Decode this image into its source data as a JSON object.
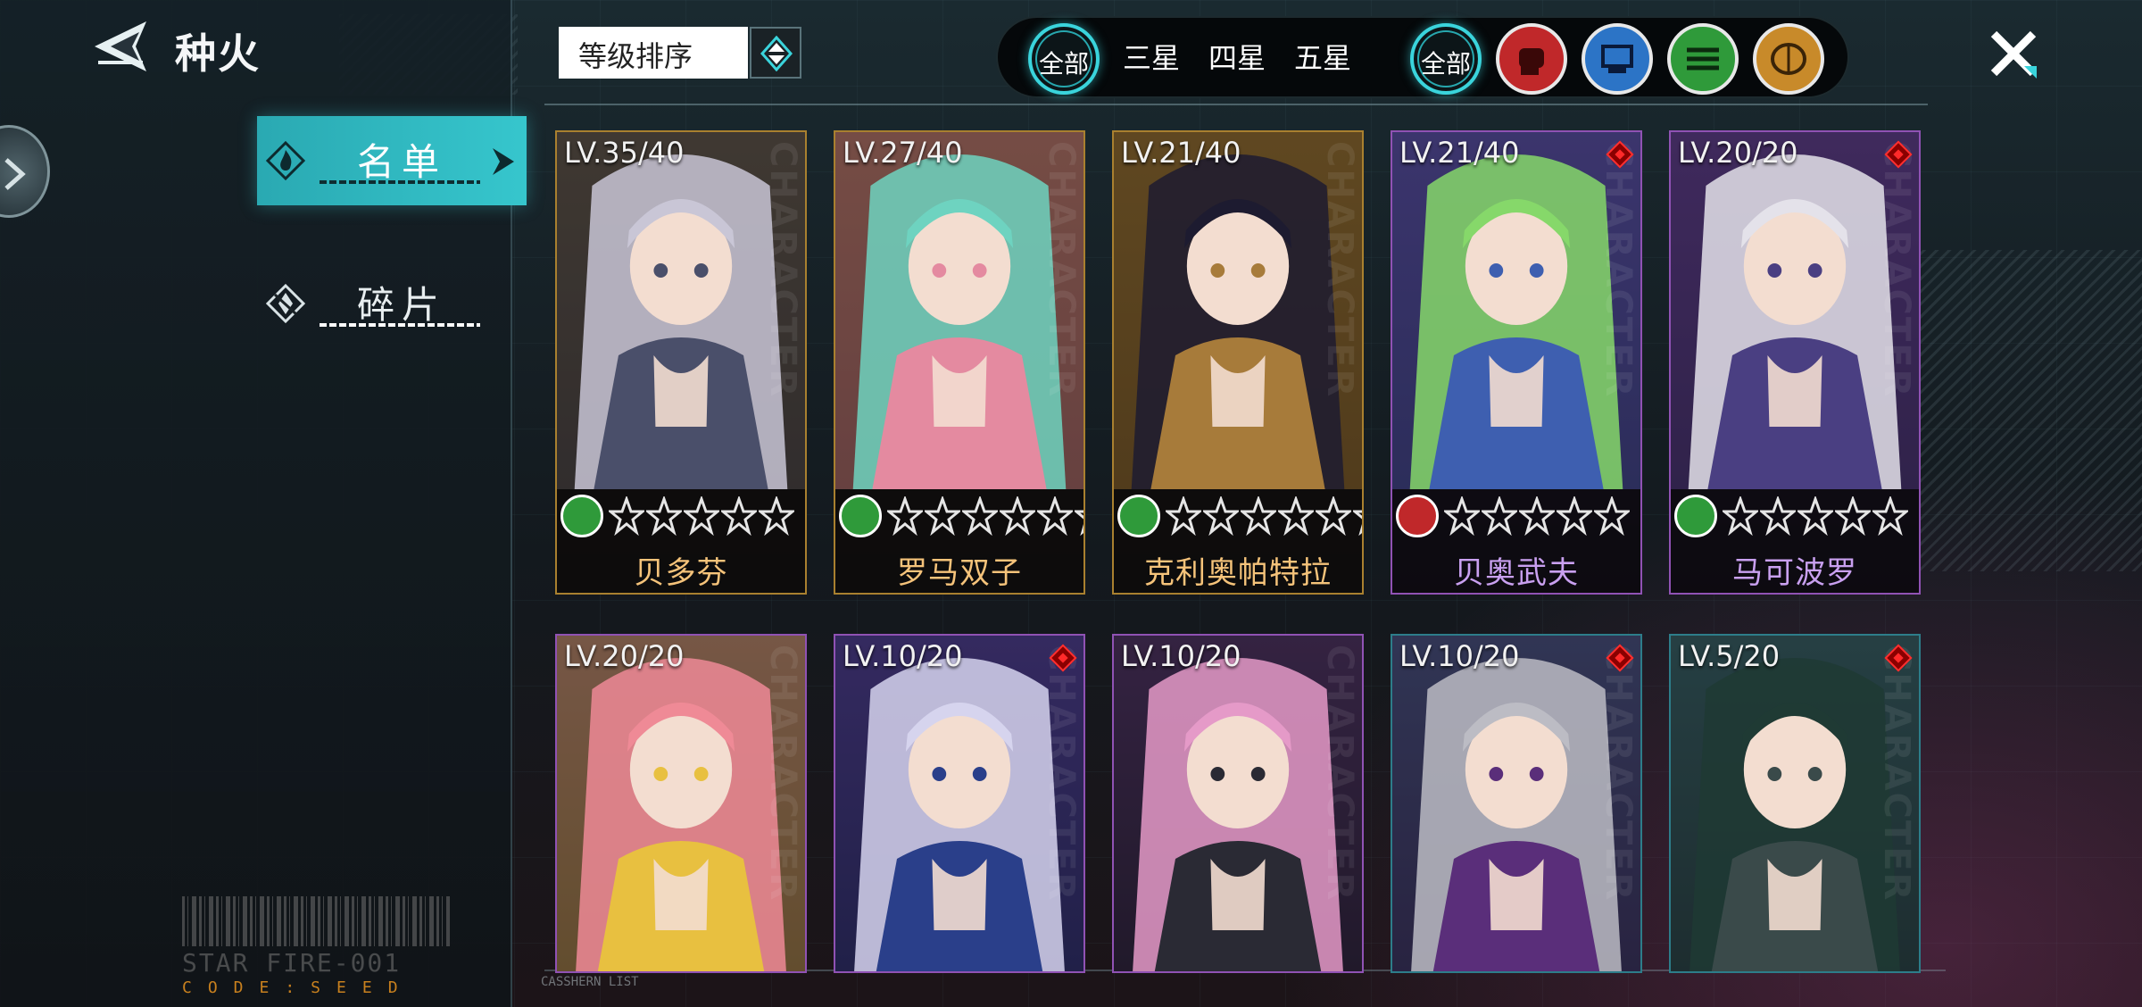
{
  "header": {
    "title": "种火",
    "back_icon": "back-arrow-icon"
  },
  "sidebar": {
    "tabs": [
      {
        "label": "名单",
        "active": true,
        "icon": "flame-icon"
      },
      {
        "label": "碎片",
        "active": false,
        "icon": "shard-icon"
      }
    ],
    "footer": {
      "line1": "STAR FIRE-001",
      "line2": "CODE:SEED"
    }
  },
  "toolbar": {
    "sort_label": "等级排序",
    "rarity_filters": [
      {
        "label": "全部",
        "selected": true
      },
      {
        "label": "三星",
        "selected": false
      },
      {
        "label": "四星",
        "selected": false
      },
      {
        "label": "五星",
        "selected": false
      }
    ],
    "class_filters": [
      {
        "label": "全部",
        "selected": true
      },
      {
        "name": "fist-class-icon",
        "color": "#c0282a"
      },
      {
        "name": "tech-class-icon",
        "color": "#2c74c6"
      },
      {
        "name": "speed-class-icon",
        "color": "#2f9a3a"
      },
      {
        "name": "mind-class-icon",
        "color": "#c88a2a"
      }
    ]
  },
  "list_caption": "CASSHERN LIST",
  "card_watermark": "CHARACTER",
  "characters": [
    {
      "level": "LV.35/40",
      "name": "贝多芬",
      "stars": 5,
      "rarity": "gold",
      "class_color": "#2f9a3a",
      "gem": false,
      "palette": [
        "#c9c6d6",
        "#4a4f6a"
      ]
    },
    {
      "level": "LV.27/40",
      "name": "罗马双子",
      "stars": 6,
      "rarity": "gold",
      "class_color": "#2f9a3a",
      "gem": false,
      "palette": [
        "#6ed3c0",
        "#e48aa0"
      ]
    },
    {
      "level": "LV.21/40",
      "name": "克利奥帕特拉",
      "stars": 6,
      "rarity": "gold",
      "class_color": "#2f9a3a",
      "gem": false,
      "palette": [
        "#1d1b30",
        "#a77b3a"
      ]
    },
    {
      "level": "LV.21/40",
      "name": "贝奥武夫",
      "stars": 5,
      "rarity": "purple",
      "class_color": "#c0282a",
      "gem": true,
      "palette": [
        "#86d86a",
        "#3e5fb0"
      ]
    },
    {
      "level": "LV.20/20",
      "name": "马可波罗",
      "stars": 5,
      "rarity": "purple",
      "class_color": "#2f9a3a",
      "gem": true,
      "palette": [
        "#e4e2ea",
        "#4a3f82"
      ]
    },
    {
      "level": "LV.20/20",
      "name": "",
      "stars": 0,
      "rarity": "purple",
      "class_color": "",
      "gem": false,
      "palette": [
        "#ef8a96",
        "#e8c040"
      ]
    },
    {
      "level": "LV.10/20",
      "name": "",
      "stars": 0,
      "rarity": "purple",
      "class_color": "",
      "gem": true,
      "palette": [
        "#d6d4ee",
        "#2a3f8a"
      ]
    },
    {
      "level": "LV.10/20",
      "name": "",
      "stars": 0,
      "rarity": "purple",
      "class_color": "",
      "gem": false,
      "palette": [
        "#e59ac8",
        "#2a2a34"
      ]
    },
    {
      "level": "LV.10/20",
      "name": "",
      "stars": 0,
      "rarity": "cyan",
      "class_color": "",
      "gem": true,
      "palette": [
        "#bcbcc4",
        "#5a2e7a"
      ]
    },
    {
      "level": "LV.5/20",
      "name": "",
      "stars": 0,
      "rarity": "cyan",
      "class_color": "",
      "gem": true,
      "palette": [
        "#1f3a34",
        "#3a4a4a"
      ]
    }
  ]
}
